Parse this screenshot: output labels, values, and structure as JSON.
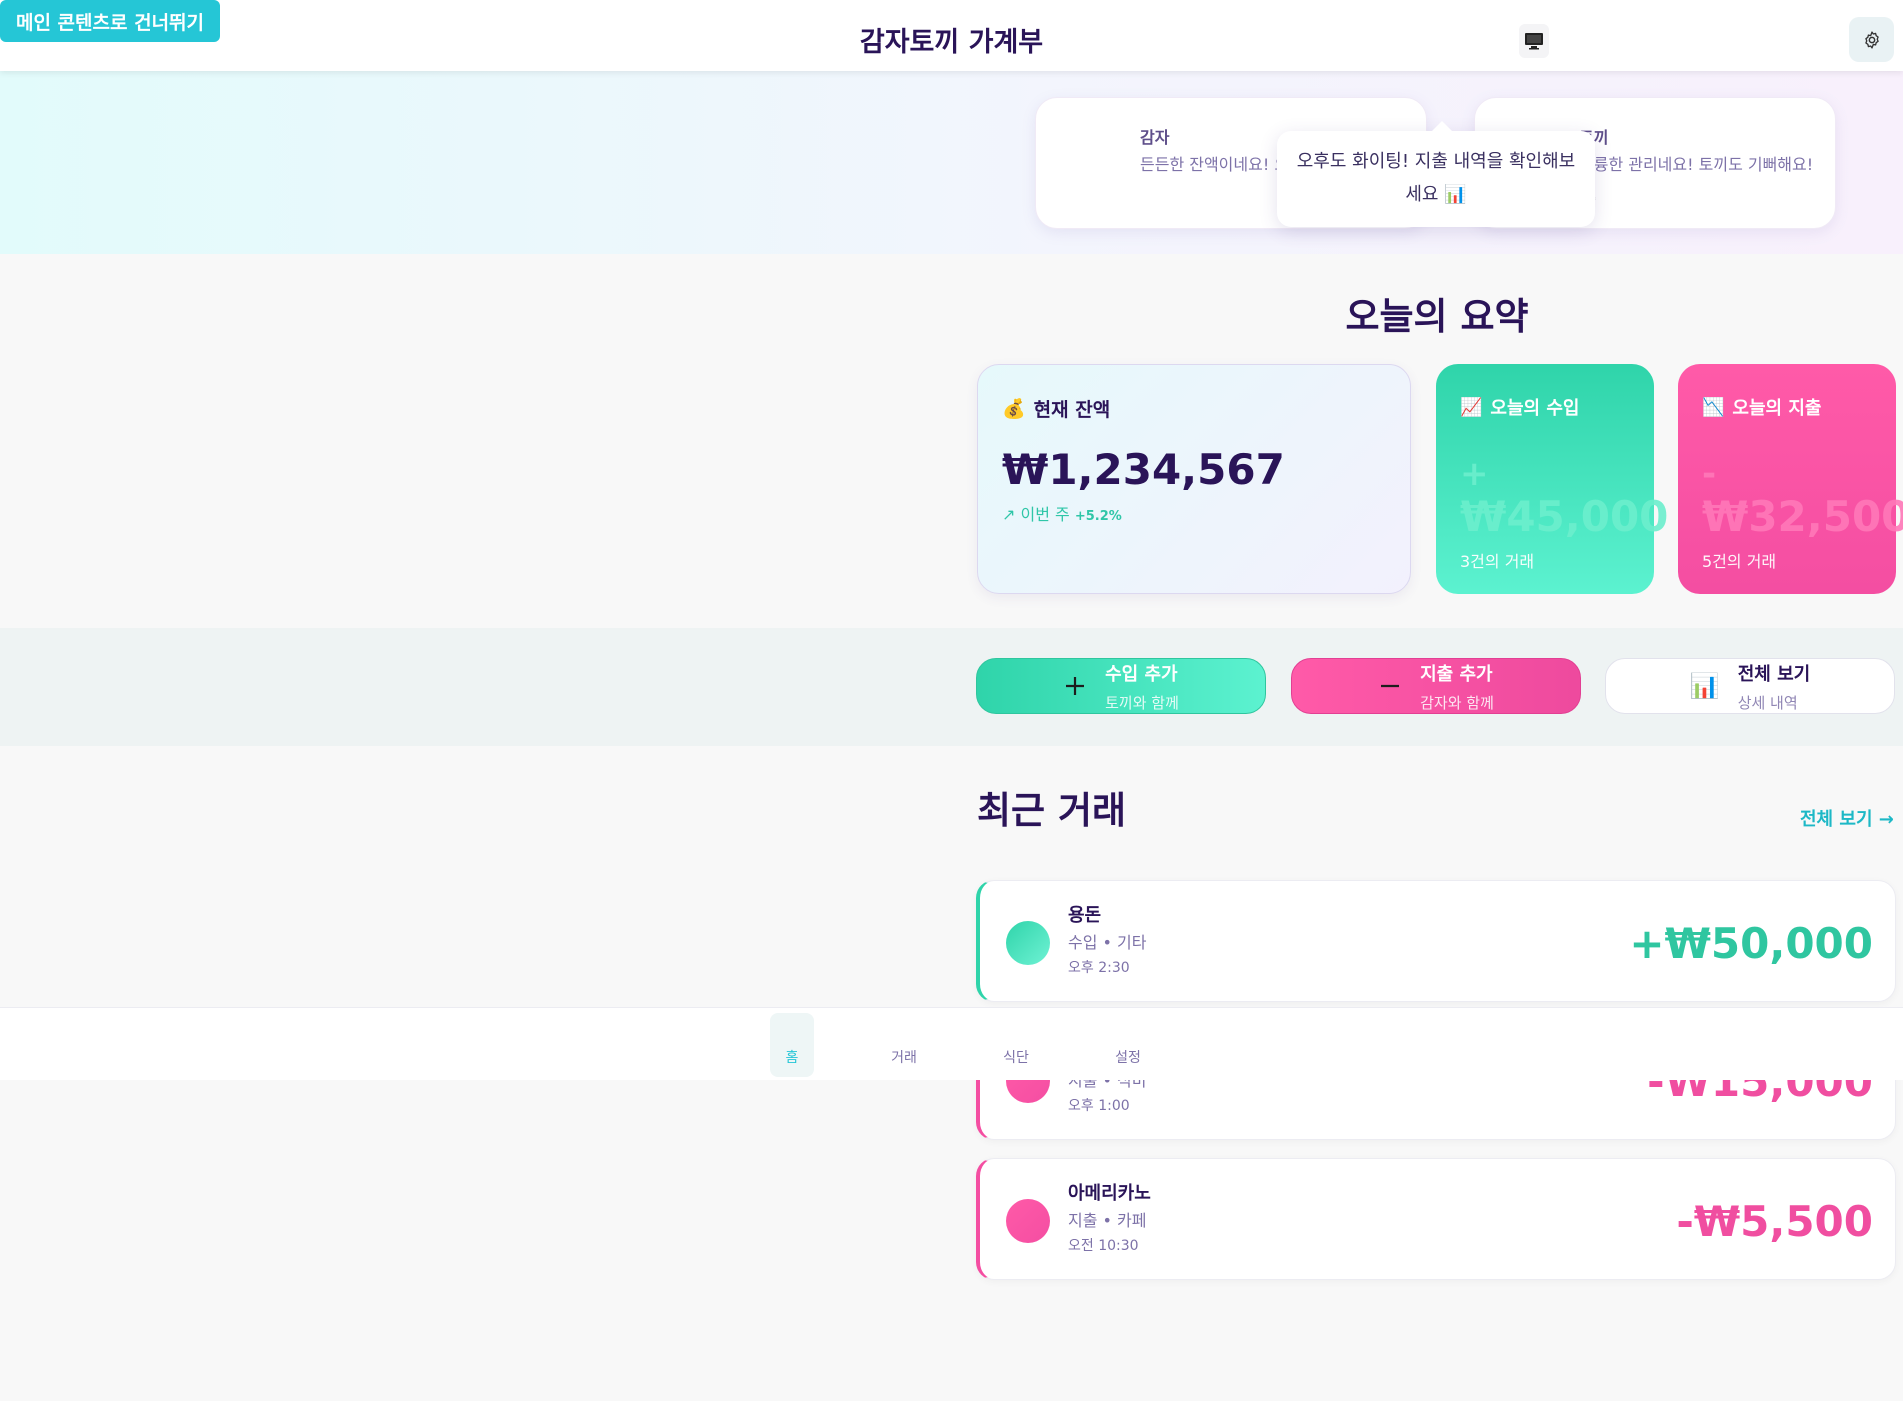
{
  "skip_link": "메인 콘텐츠로 건너뛰기",
  "header": {
    "title": "감자토끼 가계부",
    "monitor_icon": "monitor-icon",
    "settings_icon": "gear-icon"
  },
  "characters": {
    "potato": {
      "name": "감자",
      "message": "든든한 잔액이네요! 요! 🥔"
    },
    "bunny": {
      "name": "토끼",
      "message": "훌륭한 관리네요! 토끼도 기뻐해요! 🐰"
    },
    "tooltip": "오후도 화이팅! 지출 내역을 확인해보세요 📊"
  },
  "summary": {
    "title": "오늘의 요약",
    "balance": {
      "label": "현재 잔액",
      "icon": "💰",
      "amount": "₩1,234,567",
      "trend_label": "↗ 이번 주",
      "trend_value": "+5.2%"
    },
    "income": {
      "label": "오늘의 수입",
      "icon": "📈",
      "sign": "+",
      "amount": "₩45,000",
      "count": "3건의 거래"
    },
    "expense": {
      "label": "오늘의 지출",
      "icon": "📉",
      "sign": "-",
      "amount": "₩32,500",
      "count": "5건의 거래"
    }
  },
  "actions": {
    "add_income": {
      "title": "수입 추가",
      "sub": "토끼와 함께",
      "icon": "plus-icon"
    },
    "add_expense": {
      "title": "지출 추가",
      "sub": "감자와 함께",
      "icon": "minus-icon"
    },
    "view_all": {
      "title": "전체 보기",
      "sub": "상세 내역",
      "icon": "📊"
    }
  },
  "recent": {
    "title": "최근 거래",
    "view_all": "전체 보기 →",
    "items": [
      {
        "name": "용돈",
        "category": "수입 • 기타",
        "time": "오후 2:30",
        "amount": "+₩50,000",
        "kind": "in"
      },
      {
        "name": "",
        "category": "지출 • 식비",
        "time": "오후 1:00",
        "amount": "-₩15,000",
        "kind": "out"
      },
      {
        "name": "아메리카노",
        "category": "지출 • 카페",
        "time": "오전 10:30",
        "amount": "-₩5,500",
        "kind": "out"
      }
    ]
  },
  "nav": {
    "home": "홈",
    "transactions": "거래",
    "meal": "식단",
    "settings": "설정"
  },
  "colors": {
    "primary": "#25c6d6",
    "income": "#2fd4aa",
    "expense": "#f44ea2",
    "text": "#2a1458"
  }
}
